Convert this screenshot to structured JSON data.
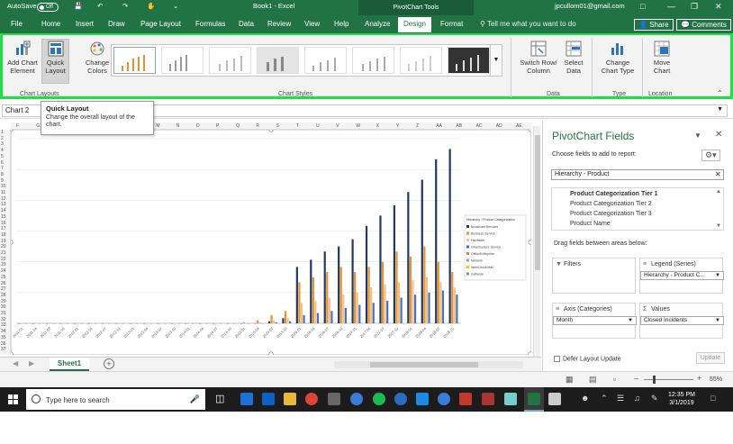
{
  "titlebar": {
    "autosave_label": "AutoSave",
    "autosave_state": "Off",
    "doc_title": "Book1 - Excel",
    "context_tools": "PivotChart Tools",
    "user": "jpcullom01@gmail.com"
  },
  "tabs": [
    "File",
    "Home",
    "Insert",
    "Draw",
    "Page Layout",
    "Formulas",
    "Data",
    "Review",
    "View",
    "Help",
    "Analyze",
    "Design",
    "Format"
  ],
  "tell_me": "Tell me what you want to do",
  "share_label": "Share",
  "comments_label": "Comments",
  "ribbon": {
    "add_chart_element": "Add Chart\nElement",
    "quick_layout": "Quick\nLayout",
    "change_colors": "Change\nColors",
    "switch_row_col": "Switch Row/\nColumn",
    "select_data": "Select\nData",
    "change_chart_type": "Change\nChart Type",
    "move_chart": "Move\nChart",
    "groups": {
      "chart_layouts": "Chart Layouts",
      "chart_styles": "Chart Styles",
      "data": "Data",
      "type": "Type",
      "location": "Location"
    }
  },
  "formula_bar": {
    "name_box": "Chart 2"
  },
  "tooltip": {
    "title": "Quick Layout",
    "description": "Change the overall layout of the chart."
  },
  "columns": [
    "F",
    "G",
    "H",
    "I",
    "J",
    "K",
    "L",
    "M",
    "N",
    "O",
    "P",
    "Q",
    "R",
    "S",
    "T",
    "U",
    "V",
    "W",
    "X",
    "Y",
    "Z",
    "AA",
    "AB",
    "AC",
    "AD",
    "AE"
  ],
  "rows": [
    "1",
    "2",
    "3",
    "4",
    "5",
    "6",
    "7",
    "8",
    "9",
    "10",
    "11",
    "12",
    "13",
    "14",
    "15",
    "16",
    "17",
    "18",
    "19",
    "20",
    "21",
    "22",
    "23",
    "24",
    "25",
    "26",
    "27",
    "28",
    "29",
    "30",
    "31",
    "32",
    "33",
    "34",
    "35",
    "36",
    "37"
  ],
  "sheet_tab": "Sheet1",
  "pivot_panel": {
    "title": "PivotChart Fields",
    "subtitle": "Choose fields to add to report:",
    "search_value": "Hierarchy - Product",
    "fields": [
      {
        "label": "Product Categorization Tier 1",
        "bold": true
      },
      {
        "label": "Product Categorization Tier 2",
        "bold": false
      },
      {
        "label": "Product Categorization Tier 3",
        "bold": false
      },
      {
        "label": "Product Name",
        "bold": false
      }
    ],
    "drag_label": "Drag fields between areas below:",
    "filters_label": "Filters",
    "legend_label": "Legend (Series)",
    "legend_value": "Hierarchy - Product C...",
    "axis_label": "Axis (Categories)",
    "axis_value": "Month",
    "values_label": "Values",
    "values_value": "Closed Incidents",
    "defer_label": "Defer Layout Update",
    "update_label": "Update"
  },
  "statusbar": {
    "zoom": "55%"
  },
  "taskbar": {
    "search_placeholder": "Type here to search",
    "time": "12:35 PM",
    "date": "3/1/2019"
  },
  "chart_data": {
    "type": "bar",
    "title": "",
    "ylabel": "",
    "xlabel": "",
    "legend_title": "Hierarchy - Product Categorization",
    "legend_position": "right",
    "categories": [
      "2011-01",
      "2011-04",
      "2011-07",
      "2011-10",
      "2012-01",
      "2012-04",
      "2012-07",
      "2012-10",
      "2013-01",
      "2013-04",
      "2013-07",
      "2013-10",
      "2014-01",
      "2014-04",
      "2014-07",
      "2014-10",
      "2015-01",
      "2015-04",
      "2015-07",
      "2015-10",
      "2016-01",
      "2016-04",
      "2016-07",
      "2016-10",
      "2017-01",
      "2017-04",
      "2017-07",
      "2017-10",
      "2018-01",
      "2018-04",
      "2018-07",
      "2018-10"
    ],
    "series": [
      {
        "name": "Broadcast Services",
        "color": "#1f3864",
        "values": [
          0,
          0,
          0,
          0,
          0,
          0,
          0,
          0,
          0,
          0,
          0,
          0,
          0,
          0,
          0,
          0,
          0,
          0,
          2,
          5,
          55,
          62,
          70,
          75,
          82,
          95,
          105,
          115,
          128,
          140,
          160,
          170
        ]
      },
      {
        "name": "Business Service",
        "color": "#e8912e",
        "values": [
          0,
          0,
          0,
          0,
          0,
          0,
          0,
          0,
          0,
          0,
          0,
          0,
          0,
          0,
          0,
          0,
          1,
          3,
          8,
          12,
          40,
          45,
          50,
          55,
          50,
          55,
          60,
          70,
          65,
          75,
          60,
          50
        ]
      },
      {
        "name": "Hardware",
        "color": "#f2c18a",
        "values": [
          0,
          0,
          0,
          0,
          0,
          0,
          0,
          0,
          0,
          0,
          0,
          0,
          0,
          0,
          0,
          0,
          0,
          1,
          3,
          5,
          20,
          22,
          25,
          28,
          30,
          35,
          38,
          40,
          42,
          45,
          40,
          35
        ]
      },
      {
        "name": "Infrastructure Service",
        "color": "#4472c4",
        "values": [
          0,
          0,
          0,
          0,
          0,
          0,
          0,
          0,
          0,
          0,
          0,
          0,
          0,
          0,
          0,
          0,
          0,
          0,
          1,
          2,
          8,
          10,
          12,
          15,
          18,
          20,
          22,
          25,
          28,
          30,
          32,
          28
        ]
      }
    ],
    "legend_entries": [
      "Broadcast Services",
      "Business Service",
      "Hardware",
      "Infrastructure Service",
      "Office/Enterprise",
      "Network",
      "Web/Cloud/Mail",
      "Software"
    ]
  }
}
